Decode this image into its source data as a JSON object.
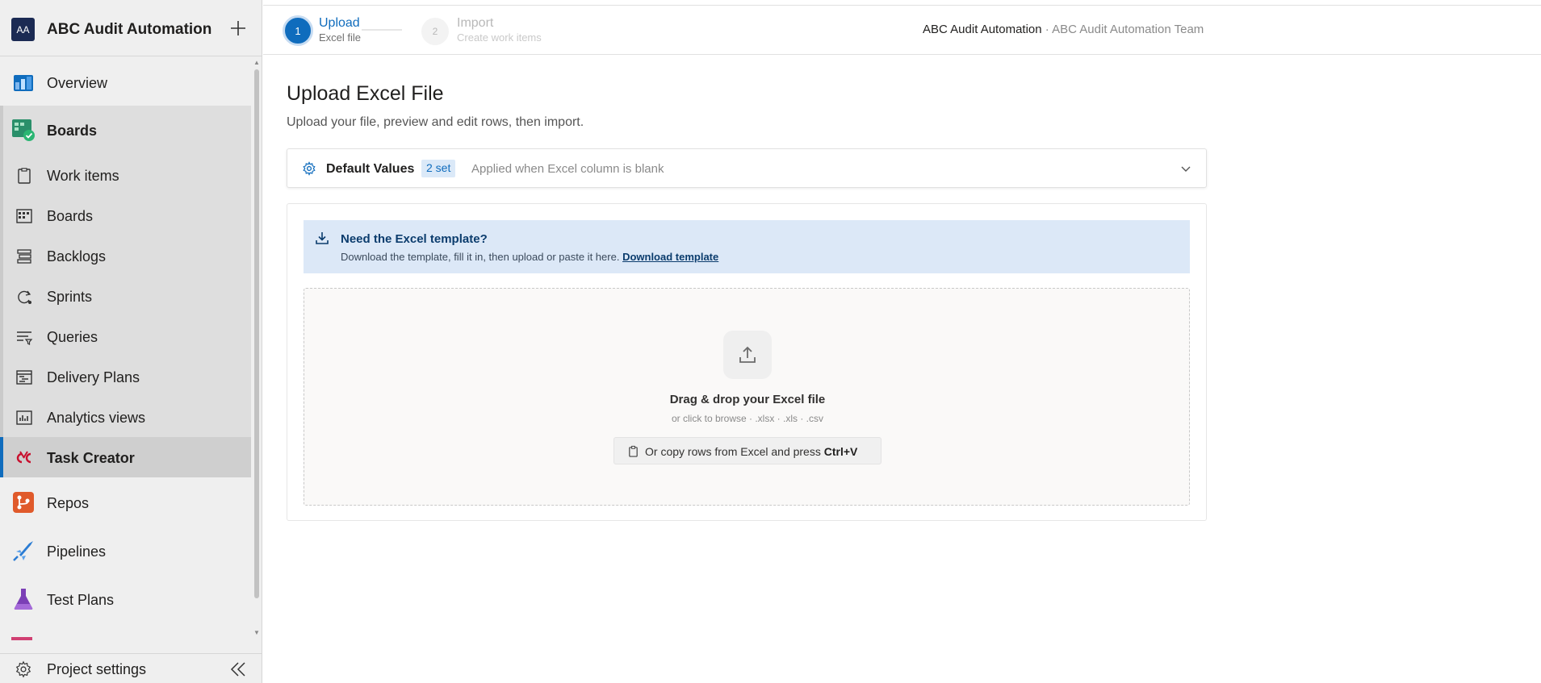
{
  "project": {
    "initials": "AA",
    "name": "ABC Audit Automation"
  },
  "sidebar": {
    "items": [
      {
        "label": "Overview",
        "icon": "overview-icon"
      },
      {
        "label": "Boards",
        "icon": "boards-hub-icon"
      },
      {
        "label": "Work items",
        "icon": "work-items-icon"
      },
      {
        "label": "Boards",
        "icon": "boards-icon"
      },
      {
        "label": "Backlogs",
        "icon": "backlogs-icon"
      },
      {
        "label": "Sprints",
        "icon": "sprints-icon"
      },
      {
        "label": "Queries",
        "icon": "queries-icon"
      },
      {
        "label": "Delivery Plans",
        "icon": "delivery-plans-icon"
      },
      {
        "label": "Analytics views",
        "icon": "analytics-views-icon"
      },
      {
        "label": "Task Creator",
        "icon": "task-creator-icon"
      },
      {
        "label": "Repos",
        "icon": "repos-icon"
      },
      {
        "label": "Pipelines",
        "icon": "pipelines-icon"
      },
      {
        "label": "Test Plans",
        "icon": "test-plans-icon"
      }
    ],
    "settings_label": "Project settings"
  },
  "stepper": {
    "step1": {
      "number": "1",
      "title": "Upload",
      "subtitle": "Excel file"
    },
    "step2": {
      "number": "2",
      "title": "Import",
      "subtitle": "Create work items"
    }
  },
  "breadcrumb": {
    "project": "ABC Audit Automation",
    "separator": " · ",
    "team": "ABC Audit Automation Team"
  },
  "main": {
    "title": "Upload Excel File",
    "subtitle": "Upload your file, preview and edit rows, then import."
  },
  "defaults": {
    "title": "Default Values",
    "badge": "2 set",
    "hint": "Applied when Excel column is blank"
  },
  "template": {
    "title": "Need the Excel template?",
    "text": "Download the template, fill it in, then upload or paste it here.",
    "link": "Download template"
  },
  "dropzone": {
    "title": "Drag & drop your Excel file",
    "subtitle": "or click to browse · .xlsx · .xls · .csv",
    "paste_text": "Or copy rows from Excel and press",
    "paste_key": "Ctrl+V"
  },
  "colors": {
    "accent": "#0f6cbd",
    "banner": "#dce8f7",
    "sidebar": "#efefef"
  }
}
